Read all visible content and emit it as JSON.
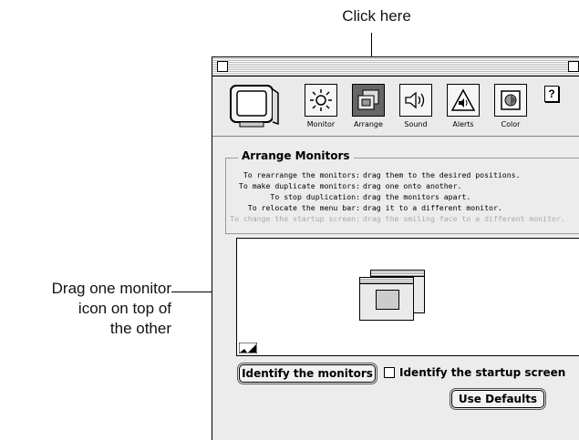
{
  "callouts": {
    "click_here": "Click here",
    "drag_line1": "Drag one monitor",
    "drag_line2": "icon on top of",
    "drag_line3": "the other"
  },
  "toolbar": {
    "items": [
      {
        "label": "Monitor",
        "icon": "sun-icon"
      },
      {
        "label": "Arrange",
        "icon": "arrange-monitors-icon",
        "selected": true
      },
      {
        "label": "Sound",
        "icon": "speaker-icon"
      },
      {
        "label": "Alerts",
        "icon": "alert-triangle-icon"
      },
      {
        "label": "Color",
        "icon": "color-icon"
      }
    ],
    "help_label": "?"
  },
  "arrange": {
    "title": "Arrange Monitors",
    "instructions": [
      {
        "key": "To rearrange the monitors:",
        "value": "drag them to the desired positions.",
        "dim": false
      },
      {
        "key": "To make duplicate monitors:",
        "value": "drag one onto another.",
        "dim": false
      },
      {
        "key": "To stop duplication:",
        "value": "drag the monitors apart.",
        "dim": false
      },
      {
        "key": "To relocate the menu bar:",
        "value": "drag it to a different monitor.",
        "dim": false
      },
      {
        "key": "To change the startup screen:",
        "value": "drag the smiling face to a different monitor.",
        "dim": true
      }
    ]
  },
  "buttons": {
    "identify": "Identify the monitors",
    "startup_check": "Identify the startup screen",
    "defaults": "Use Defaults"
  }
}
